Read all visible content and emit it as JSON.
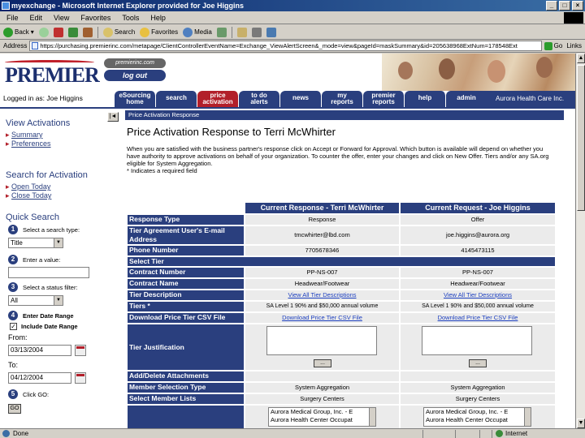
{
  "window": {
    "title": "myexchange - Microsoft Internet Explorer provided for Joe Higgins",
    "controls": [
      "_",
      "□",
      "×"
    ]
  },
  "menu": [
    "File",
    "Edit",
    "View",
    "Favorites",
    "Tools",
    "Help"
  ],
  "toolbar": {
    "back": "Back",
    "search": "Search",
    "favorites": "Favorites",
    "media": "Media"
  },
  "address": {
    "label": "Address",
    "url": "https://purchasing.premierinc.com/metapage/ClientControllerEventName=Exchange_ViewAlertScreen&_mode=view&pageId=maskSummary&id=205638968ExtNum=178548Ext",
    "go": "Go",
    "links": "Links"
  },
  "header": {
    "logo": "PREMIER",
    "site": "premierinc.com",
    "logout": "log out"
  },
  "nav": {
    "logged_in": "Logged in as: Joe Higgins",
    "tabs": [
      {
        "line1": "eSourcing",
        "line2": "home"
      },
      {
        "line1": "search",
        "line2": ""
      },
      {
        "line1": "price",
        "line2": "activation"
      },
      {
        "line1": "to do",
        "line2": "alerts"
      },
      {
        "line1": "news",
        "line2": ""
      },
      {
        "line1": "my",
        "line2": "reports"
      },
      {
        "line1": "premier",
        "line2": "reports"
      },
      {
        "line1": "help",
        "line2": ""
      },
      {
        "line1": "admin",
        "line2": ""
      }
    ],
    "facility": "Aurora Health Care Inc."
  },
  "sidebar": {
    "collapse": "|◄",
    "view_heading": "View Activations",
    "view_links": [
      "Summary",
      "Preferences"
    ],
    "search_heading": "Search for Activation",
    "search_links": [
      "Open Today",
      "Close Today"
    ],
    "quick_heading": "Quick Search",
    "step1": "Select a search type:",
    "step1_value": "Title",
    "step2": "Enter a value:",
    "step2_value": "",
    "step3": "Select a status filter:",
    "step3_value": "All",
    "step4": "Enter Date Range",
    "include_date_range": "Include Date Range",
    "from_label": "From:",
    "from_value": "03/13/2004",
    "to_label": "To:",
    "to_value": "04/12/2004",
    "step5": "Click GO:",
    "go": "GO",
    "step_numbers": [
      "1",
      "2",
      "3",
      "4",
      "5"
    ]
  },
  "main": {
    "banner": "Price Activation Response",
    "title": "Price Activation Response to Terri McWhirter",
    "desc_line1": "When you are satisfied with the business partner's response click on Accept or Forward for Approval. Which button is available will depend on whether you",
    "desc_line2": "have authority to approve activations on behalf of your organization. To counter the offer, enter your changes and click on New Offer. Tiers and/or any SA.org",
    "desc_line3": "eligible for System Aggregation.",
    "desc_line4": "* Indicates a required field",
    "col1_header": "Current Response - Terri McWhirter",
    "col2_header": "Current Request - Joe Higgins",
    "rows": [
      {
        "label": "Response Type",
        "c1": "Response",
        "c2": "Offer"
      },
      {
        "label": "Tier Agreement User's E-mail Address",
        "c1": "tmcwhirter@lbd.com",
        "c2": "joe.higgins@aurora.org"
      },
      {
        "label": "Phone Number",
        "c1": "7705678346",
        "c2": "4145473115"
      },
      {
        "label": "Contract Number",
        "c1": "PP-NS-007",
        "c2": "PP-NS-007"
      },
      {
        "label": "Contract Name",
        "c1": "Headwear/Footwear",
        "c2": "Headwear/Footwear"
      },
      {
        "label": "Tier Description",
        "c1": "View All Tier Descriptions",
        "c2": "View All Tier Descriptions"
      },
      {
        "label": "Tiers *",
        "c1": "SA Level 1 90% and $50,000 annual volume",
        "c2": "SA Level 1 90% and $50,000 annual volume"
      },
      {
        "label": "Download Price Tier CSV File",
        "c1": "Download Price Tier CSV File",
        "c2": "Download Price Tier CSV File"
      }
    ],
    "select_tier": "Select Tier",
    "justification_label": "Tier Justification",
    "dots": "...",
    "add_delete": "Add/Delete Attachments",
    "member_selection_label": "Member Selection Type",
    "member_selection_c1": "System Aggregation",
    "member_selection_c2": "System Aggregation",
    "select_member_label": "Select Member Lists",
    "select_member_c1": "Surgery Centers",
    "select_member_c2": "Surgery Centers",
    "list_c1": [
      "Aurora Medical Group, Inc. - E",
      "Aurora Health Center Occupat"
    ],
    "list_c2": [
      "Aurora Medical Group, Inc. - E",
      "Aurora Health Center Occupat"
    ]
  },
  "status": {
    "left": "Done",
    "zone": "Internet"
  }
}
